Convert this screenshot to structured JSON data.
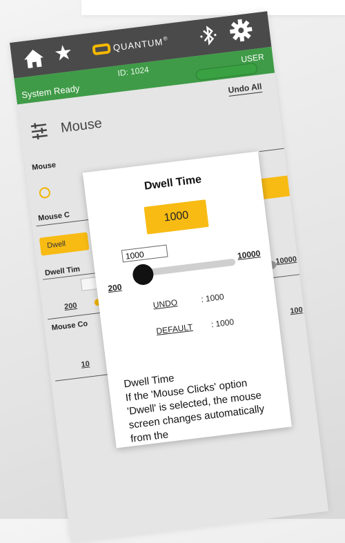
{
  "header": {
    "logo_text": "QUANTUM",
    "logo_mark": "®",
    "id_label": "ID: 1024",
    "user_label": "USER",
    "status": "System Ready",
    "undo_all": "Undo All"
  },
  "icons": {
    "home": "home-icon",
    "star": "star-icon",
    "bluetooth": "bluetooth-icon",
    "settings": "gear-icon",
    "sliders": "sliders-icon"
  },
  "page": {
    "title": "Mouse"
  },
  "background": {
    "mouse_label": "Mouse",
    "mouse_clicks_label": "Mouse C",
    "dwell_button": "Dwell",
    "dwell_time_label": "Dwell Tim",
    "dwell_min": "200",
    "dwell_max": "10000",
    "mouse_cont_label": "Mouse Co",
    "cont_min": "10",
    "cont_max": "100"
  },
  "dialog": {
    "title": "Dwell Time",
    "current_value": "1000",
    "input_value": "1000",
    "min_label": "200",
    "max_label": "10000",
    "undo_label": "UNDO",
    "undo_value": ": 1000",
    "default_label": "DEFAULT",
    "default_value": ": 1000",
    "desc_title": "Dwell Time",
    "desc_text": "If the 'Mouse Clicks' option 'Dwell' is selected, the mouse screen changes automatically from the"
  },
  "colors": {
    "topbar": "#4a4a4a",
    "status_bar": "#3f9b47",
    "accent": "#f7bb14"
  },
  "slider": {
    "value_fraction": 0.08
  }
}
